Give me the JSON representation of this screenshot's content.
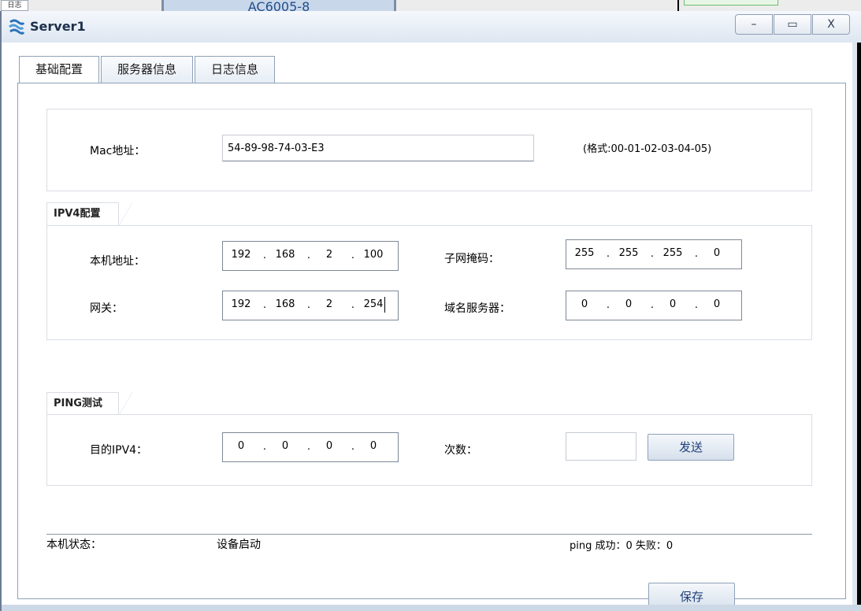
{
  "background": {
    "left_label": "日志",
    "device_label": "AC6005-8"
  },
  "window": {
    "title": "Server1",
    "controls": {
      "minimize": "–",
      "maximize": "▭",
      "close": "X"
    }
  },
  "tabs": [
    {
      "label": "基础配置",
      "active": true
    },
    {
      "label": "服务器信息",
      "active": false
    },
    {
      "label": "日志信息",
      "active": false
    }
  ],
  "mac": {
    "label": "Mac地址：",
    "value": "54-89-98-74-03-E3",
    "format_hint": "(格式:00-01-02-03-04-05)"
  },
  "ipv4": {
    "legend": "IPV4配置",
    "local_address_label": "本机地址：",
    "local_address": [
      "192",
      "168",
      "2",
      "100"
    ],
    "subnet_mask_label": "子网掩码：",
    "subnet_mask": [
      "255",
      "255",
      "255",
      "0"
    ],
    "gateway_label": "网关：",
    "gateway": [
      "192",
      "168",
      "2",
      "254"
    ],
    "dns_label": "域名服务器：",
    "dns": [
      "0",
      "0",
      "0",
      "0"
    ]
  },
  "ping": {
    "legend": "PING测试",
    "dest_label": "目的IPV4：",
    "dest": [
      "0",
      "0",
      "0",
      "0"
    ],
    "count_label": "次数：",
    "count_value": "",
    "send_label": "发送"
  },
  "status": {
    "label": "本机状态：",
    "value": "设备启动",
    "ping_result": "ping 成功：0 失败：0"
  },
  "save_label": "保存",
  "colors": {
    "titlebar": "#dde6f1",
    "button_text": "#1f3f78",
    "tab_border": "#8ea1b8"
  }
}
